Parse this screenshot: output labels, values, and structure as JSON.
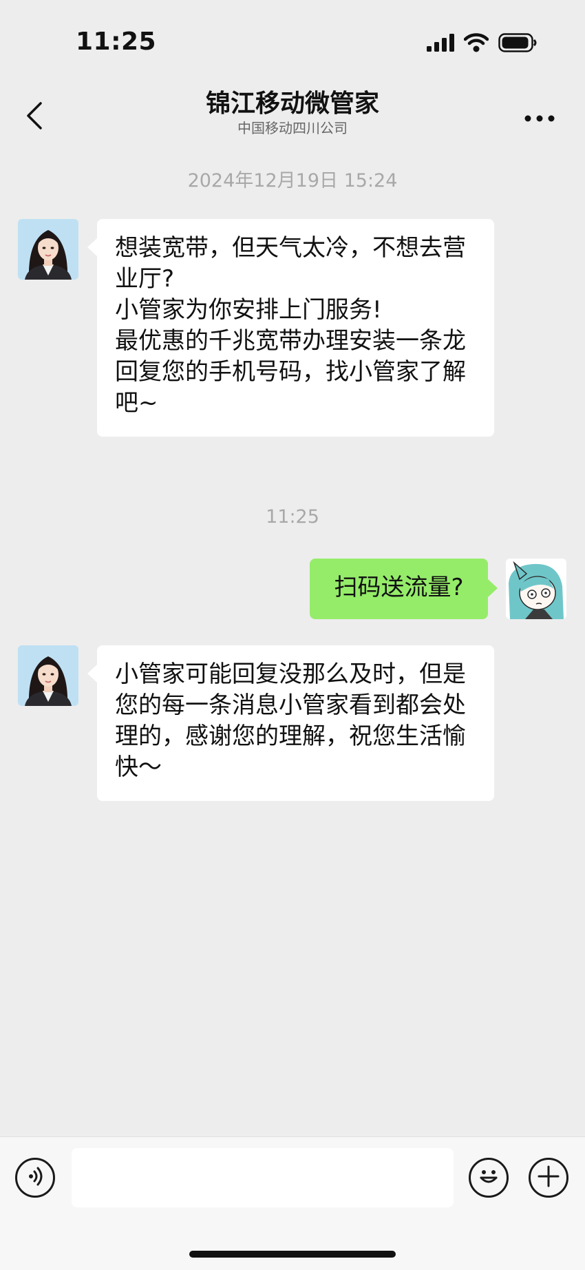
{
  "status_bar": {
    "time": "11:25",
    "icons": [
      "signal-icon",
      "wifi-icon",
      "battery-icon"
    ]
  },
  "header": {
    "title": "锦江移动微管家",
    "subtitle": "中国移动四川公司",
    "back_icon": "chevron-left-icon",
    "more_icon": "more-icon"
  },
  "messages": [
    {
      "type": "timestamp",
      "text": "2024年12月19日 15:24"
    },
    {
      "type": "incoming",
      "avatar": "assistant-avatar",
      "text": "想装宽带，但天气太冷，不想去营业厅?\n小管家为你安排上门服务!\n最优惠的千兆宽带办理安装一条龙\n回复您的手机号码，找小管家了解吧~"
    },
    {
      "type": "timestamp",
      "text": "11:25"
    },
    {
      "type": "outgoing",
      "avatar": "user-avatar",
      "text": "扫码送流量?"
    },
    {
      "type": "incoming",
      "avatar": "assistant-avatar",
      "text": "小管家可能回复没那么及时，但是您的每一条消息小管家看到都会处理的，感谢您的理解，祝您生活愉快～"
    }
  ],
  "input_bar": {
    "voice_icon": "voice-icon",
    "input_value": "",
    "emoji_icon": "emoji-icon",
    "plus_icon": "plus-icon"
  },
  "colors": {
    "background": "#ededed",
    "outgoing_bubble": "#95ec69",
    "incoming_bubble": "#ffffff",
    "timestamp_text": "#a8a8a8"
  }
}
